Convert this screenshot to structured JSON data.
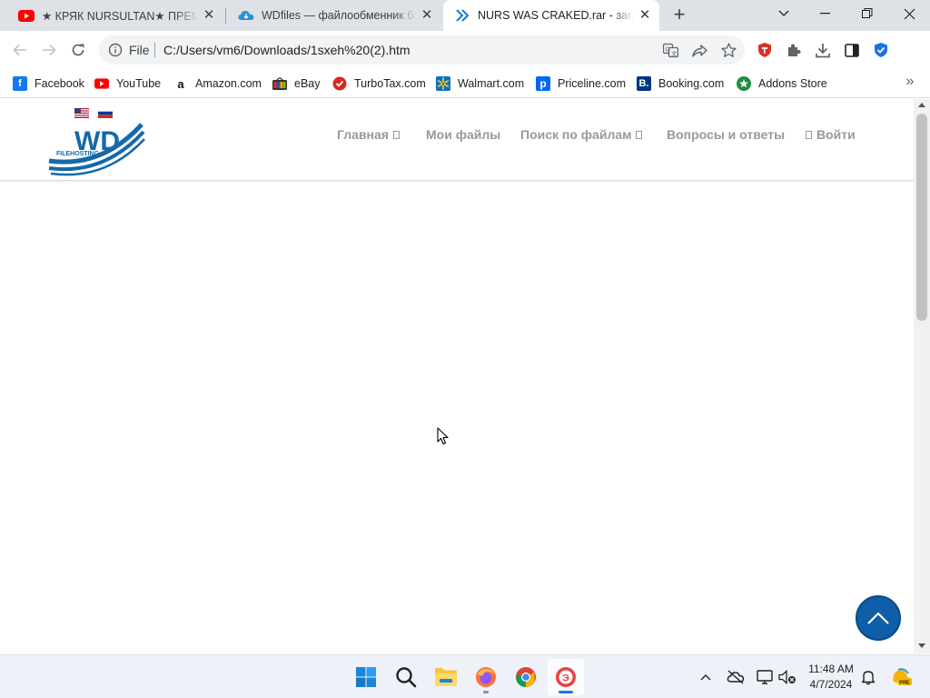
{
  "tabs": [
    {
      "title": "★ КРЯК NURSULTAN★ ПРЕМИУМ",
      "favicon": "youtube-icon",
      "active": false
    },
    {
      "title": "WDfiles — файлообменник без ограничений",
      "favicon": "cloud-icon",
      "active": false
    },
    {
      "title": "NURS WAS CRAKED.rar - загрузка",
      "favicon": "wd-chevron-icon",
      "active": true
    }
  ],
  "new_tab_label": "+",
  "address_bar": {
    "scheme_label": "File",
    "url": "C:/Users/vm6/Downloads/1sxeh%20(2).htm"
  },
  "bookmarks": [
    {
      "label": "Facebook",
      "icon": "facebook-icon"
    },
    {
      "label": "YouTube",
      "icon": "youtube-icon"
    },
    {
      "label": "Amazon.com",
      "icon": "amazon-icon"
    },
    {
      "label": "eBay",
      "icon": "ebay-icon"
    },
    {
      "label": "TurboTax.com",
      "icon": "turbotax-icon"
    },
    {
      "label": "Walmart.com",
      "icon": "walmart-icon"
    },
    {
      "label": "Priceline.com",
      "icon": "priceline-icon"
    },
    {
      "label": "Booking.com",
      "icon": "booking-icon"
    },
    {
      "label": "Addons Store",
      "icon": "addons-store-icon"
    }
  ],
  "site": {
    "logo_text": "WD",
    "logo_subtext": "FILEHOSTING",
    "nav": [
      {
        "label": "Главная",
        "glyph": "after"
      },
      {
        "label": "Мои файлы",
        "glyph": "none"
      },
      {
        "label": "Поиск по файлам",
        "glyph": "after"
      },
      {
        "label": "Вопросы и ответы",
        "glyph": "none"
      },
      {
        "label": "Войти",
        "glyph": "before"
      }
    ]
  },
  "taskbar": {
    "apps": [
      "windows-start-icon",
      "search-icon",
      "file-explorer-icon",
      "firefox-icon",
      "chrome-icon",
      "browser-app-icon"
    ],
    "time": "11:48 AM",
    "date": "4/7/2024"
  },
  "colors": {
    "accent_blue": "#1a73e8",
    "logo_blue": "#1569a8",
    "nav_gray": "#999999",
    "to_top_button": "#0e5ea8"
  }
}
